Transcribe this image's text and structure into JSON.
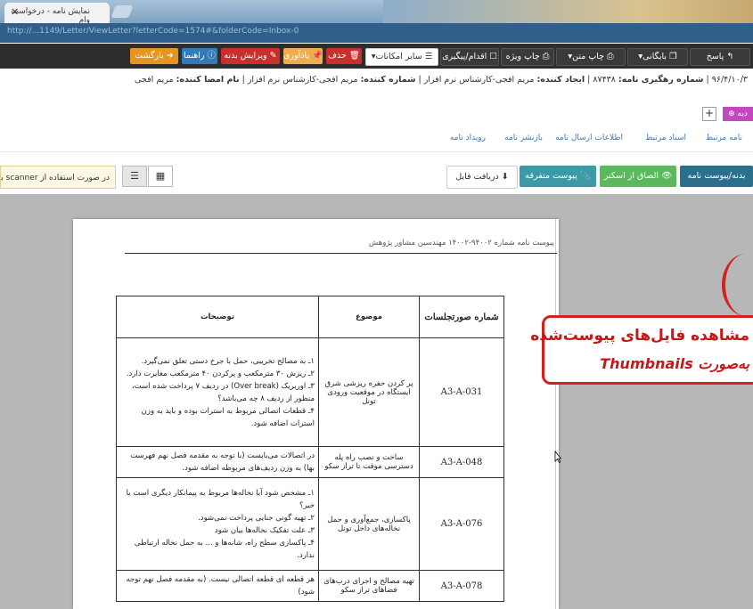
{
  "browser": {
    "tab_title": "نمایش نامه - درخواست وام",
    "close_label": "✕",
    "url": "http://...1149/Letter/ViewLetter?letterCode=1574#&folderCode=Inbox-0"
  },
  "toolbar": {
    "reply": "پاسخ",
    "archive": "بایگانی",
    "print_text": "چاپ متن",
    "print_special": "چاپ ویژه",
    "action_followup": "اقدام/پیگیری",
    "other_options": "سایر امکانات",
    "delete": "حذف",
    "reminder": "یادآوری",
    "edit_body": "ویرایش بدنه",
    "help": "راهنما",
    "back": "بازگشت"
  },
  "letter_info": {
    "date_fragment": "۹۶/۴/۱۰/۳",
    "tracking_label": "شماره رهگیری نامه:",
    "tracking_value": "۸۷۴۳۸",
    "creator_label": "ایجاد کننده:",
    "creator_value": "مریم افجی-کارشناس نرم افزار",
    "numberer_label": "شماره کننده:",
    "numberer_value": "مریم افجی-کارشناس نرم افزار",
    "signer_label": "نام امضا کننده:",
    "signer_value": "مریم افجی"
  },
  "tag_label": "دیه",
  "plus_label": "+",
  "nav_tabs": [
    "نامه مرتبط",
    "اسناد مرتبط",
    "اطلاعات ارسال نامه",
    "بازنشر نامه",
    "رویداد نامه"
  ],
  "scanner_note": "در صورت استفاده از scanner برای",
  "attach_buttons": {
    "attach_body": "بدنه/پیوست نامه",
    "attach_scanner": "الصاق از اسکنر",
    "misc_attach": "پیوست متفرقه",
    "get_file": "دریافت فایل"
  },
  "view_icons": {
    "grid": "▦",
    "list": "☰"
  },
  "document": {
    "header_text": "پیوست نامه شماره ۹۴۰۰۲-۱۴۰۰۲ مهندسین مشاور پژوهش",
    "columns": [
      "شماره صورتجلسات",
      "موضوع",
      "توضیحات"
    ],
    "rows": [
      {
        "code": "A3-A-031",
        "subject": "پر کردن حفره ریزشی شرق ایستگاه در موقعیت ورودی تونل",
        "desc": [
          "۱ـ به مصالح تخریبی، حمل با جرخ دستی تعلق نمی‌گیرد.",
          "۲ـ ریزش ۳۰ مترمکعب و پرکردن ۴۰ مترمکعب مغایرت دارد.",
          "۳ـ اوربریک (Over break) در ردیف ۷ پرداخت شده است، منظور از ردیف ۸ چه می‌باشد؟",
          "۴ـ قطعات اتصالی مربوط به استرات بوده و باید به وزن استرات اضافه شود."
        ]
      },
      {
        "code": "A3-A-048",
        "subject": "ساخت و نصب راه پله دسترسی موقت تا تراز سکو",
        "desc": [
          "در اتصالات می‌بایست (با توجه به مقدمه فصل نهم فهرست بها) به وزن ردیف‌های مربوطه اضافه شود."
        ]
      },
      {
        "code": "A3-A-076",
        "subject": "پاکسازی، جمع‌آوری و حمل نخاله‌های داخل تونل",
        "desc": [
          "۱ـ مشخص شود آیا نخاله‌ها مربوط به پیمانکار دیگری است یا خیر؟",
          "۲ـ تهیه گونی جنایی پرداخت نمی‌شود.",
          "۳ـ علت تفکیک نخاله‌ها بیان شود",
          "۴ـ پاکسازی سطح راه، شانه‌ها و ... به حمل نخاله ارتباطی ندارد."
        ]
      },
      {
        "code": "A3-A-078",
        "subject": "تهیه مصالح و اجرای درب‌های فضاهای تراز سکو",
        "desc": [
          "هر قطعه ای قطعه اتصالی نیست. (به مقدمه فصل نهم توجه شود)"
        ]
      }
    ]
  },
  "callout": {
    "line1": "مشاهده فایل‌های پیوست‌شده",
    "line2": "به‌صورت Thumbnails"
  },
  "colors": {
    "callout_red": "#d3211c",
    "toolbar_bg": "#2d2d2d",
    "delete_btn": "#c9302c",
    "reminder_btn": "#f0ad4e",
    "help_btn": "#337ab7",
    "edit_btn": "#c9302c",
    "back_btn": "#e69521"
  }
}
